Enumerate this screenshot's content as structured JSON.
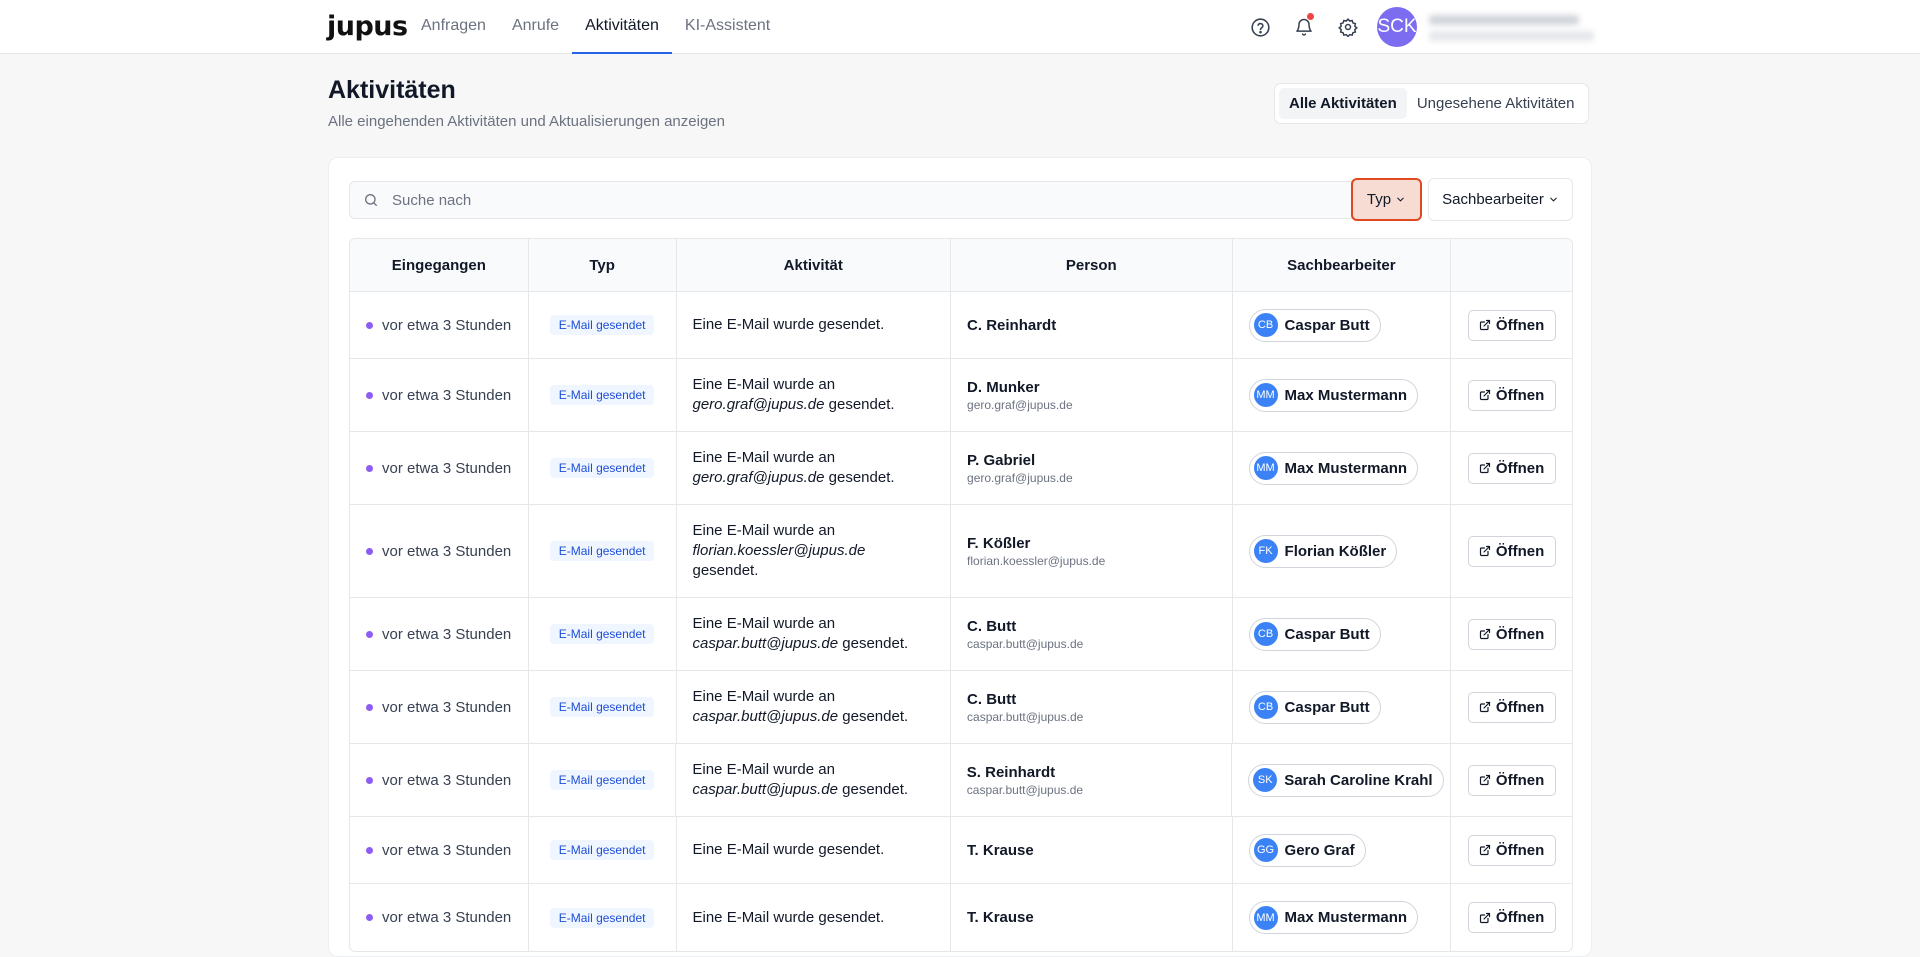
{
  "app": {
    "logo": "jupus"
  },
  "nav": [
    {
      "label": "Anfragen",
      "active": false
    },
    {
      "label": "Anrufe",
      "active": false
    },
    {
      "label": "Aktivitäten",
      "active": true
    },
    {
      "label": "KI-Assistent",
      "active": false
    }
  ],
  "header_icons": [
    "help-icon",
    "bell-icon",
    "gear-icon"
  ],
  "user": {
    "initials": "SCK"
  },
  "page": {
    "title": "Aktivitäten",
    "subtitle": "Alle eingehenden Aktivitäten und Aktualisierungen anzeigen",
    "segments": [
      {
        "label": "Alle Aktivitäten",
        "active": true
      },
      {
        "label": "Ungesehene Aktivitäten",
        "active": false
      }
    ]
  },
  "search": {
    "placeholder": "Suche nach",
    "value": ""
  },
  "filters": {
    "typ": "Typ",
    "sachbearbeiter": "Sachbearbeiter"
  },
  "table": {
    "columns": [
      "Eingegangen",
      "Typ",
      "Aktivität",
      "Person",
      "Sachbearbeiter",
      ""
    ],
    "open_label": "Öffnen",
    "rows": [
      {
        "received": "vor etwa 3 Stunden",
        "type": "E-Mail gesendet",
        "act_pre": "Eine E-Mail wurde gesendet.",
        "act_email": "",
        "act_post": "",
        "person": "C. Reinhardt",
        "person_email": "",
        "agent_initials": "CB",
        "agent": "Caspar Butt"
      },
      {
        "received": "vor etwa 3 Stunden",
        "type": "E-Mail gesendet",
        "act_pre": "Eine E-Mail wurde an",
        "act_email": "gero.graf@jupus.de",
        "act_post": "gesendet.",
        "person": "D. Munker",
        "person_email": "gero.graf@jupus.de",
        "agent_initials": "MM",
        "agent": "Max Mustermann"
      },
      {
        "received": "vor etwa 3 Stunden",
        "type": "E-Mail gesendet",
        "act_pre": "Eine E-Mail wurde an",
        "act_email": "gero.graf@jupus.de",
        "act_post": "gesendet.",
        "person": "P. Gabriel",
        "person_email": "gero.graf@jupus.de",
        "agent_initials": "MM",
        "agent": "Max Mustermann"
      },
      {
        "received": "vor etwa 3 Stunden",
        "type": "E-Mail gesendet",
        "act_pre": "Eine E-Mail wurde an",
        "act_email": "florian.koessler@jupus.de",
        "act_post": "gesendet.",
        "person": "F. Kößler",
        "person_email": "florian.koessler@jupus.de",
        "agent_initials": "FK",
        "agent": "Florian Kößler"
      },
      {
        "received": "vor etwa 3 Stunden",
        "type": "E-Mail gesendet",
        "act_pre": "Eine E-Mail wurde an",
        "act_email": "caspar.butt@jupus.de",
        "act_post": "gesendet.",
        "person": "C. Butt",
        "person_email": "caspar.butt@jupus.de",
        "agent_initials": "CB",
        "agent": "Caspar Butt"
      },
      {
        "received": "vor etwa 3 Stunden",
        "type": "E-Mail gesendet",
        "act_pre": "Eine E-Mail wurde an",
        "act_email": "caspar.butt@jupus.de",
        "act_post": "gesendet.",
        "person": "C. Butt",
        "person_email": "caspar.butt@jupus.de",
        "agent_initials": "CB",
        "agent": "Caspar Butt"
      },
      {
        "received": "vor etwa 3 Stunden",
        "type": "E-Mail gesendet",
        "act_pre": "Eine E-Mail wurde an",
        "act_email": "caspar.butt@jupus.de",
        "act_post": "gesendet.",
        "person": "S. Reinhardt",
        "person_email": "caspar.butt@jupus.de",
        "agent_initials": "SK",
        "agent": "Sarah Caroline Krahl"
      },
      {
        "received": "vor etwa 3 Stunden",
        "type": "E-Mail gesendet",
        "act_pre": "Eine E-Mail wurde gesendet.",
        "act_email": "",
        "act_post": "",
        "person": "T. Krause",
        "person_email": "",
        "agent_initials": "GG",
        "agent": "Gero Graf"
      },
      {
        "received": "vor etwa 3 Stunden",
        "type": "E-Mail gesendet",
        "act_pre": "Eine E-Mail wurde gesendet.",
        "act_email": "",
        "act_post": "",
        "person": "T. Krause",
        "person_email": "",
        "agent_initials": "MM",
        "agent": "Max Mustermann"
      }
    ]
  },
  "colors": {
    "accent": "#2563eb",
    "unread_dot": "#8b5cf6",
    "badge_bg": "#eff6ff",
    "badge_text": "#1d4ed8",
    "avatar": "#3b82f6",
    "user_avatar": "#7c6cf0",
    "typ_highlight": "#e0481f"
  }
}
